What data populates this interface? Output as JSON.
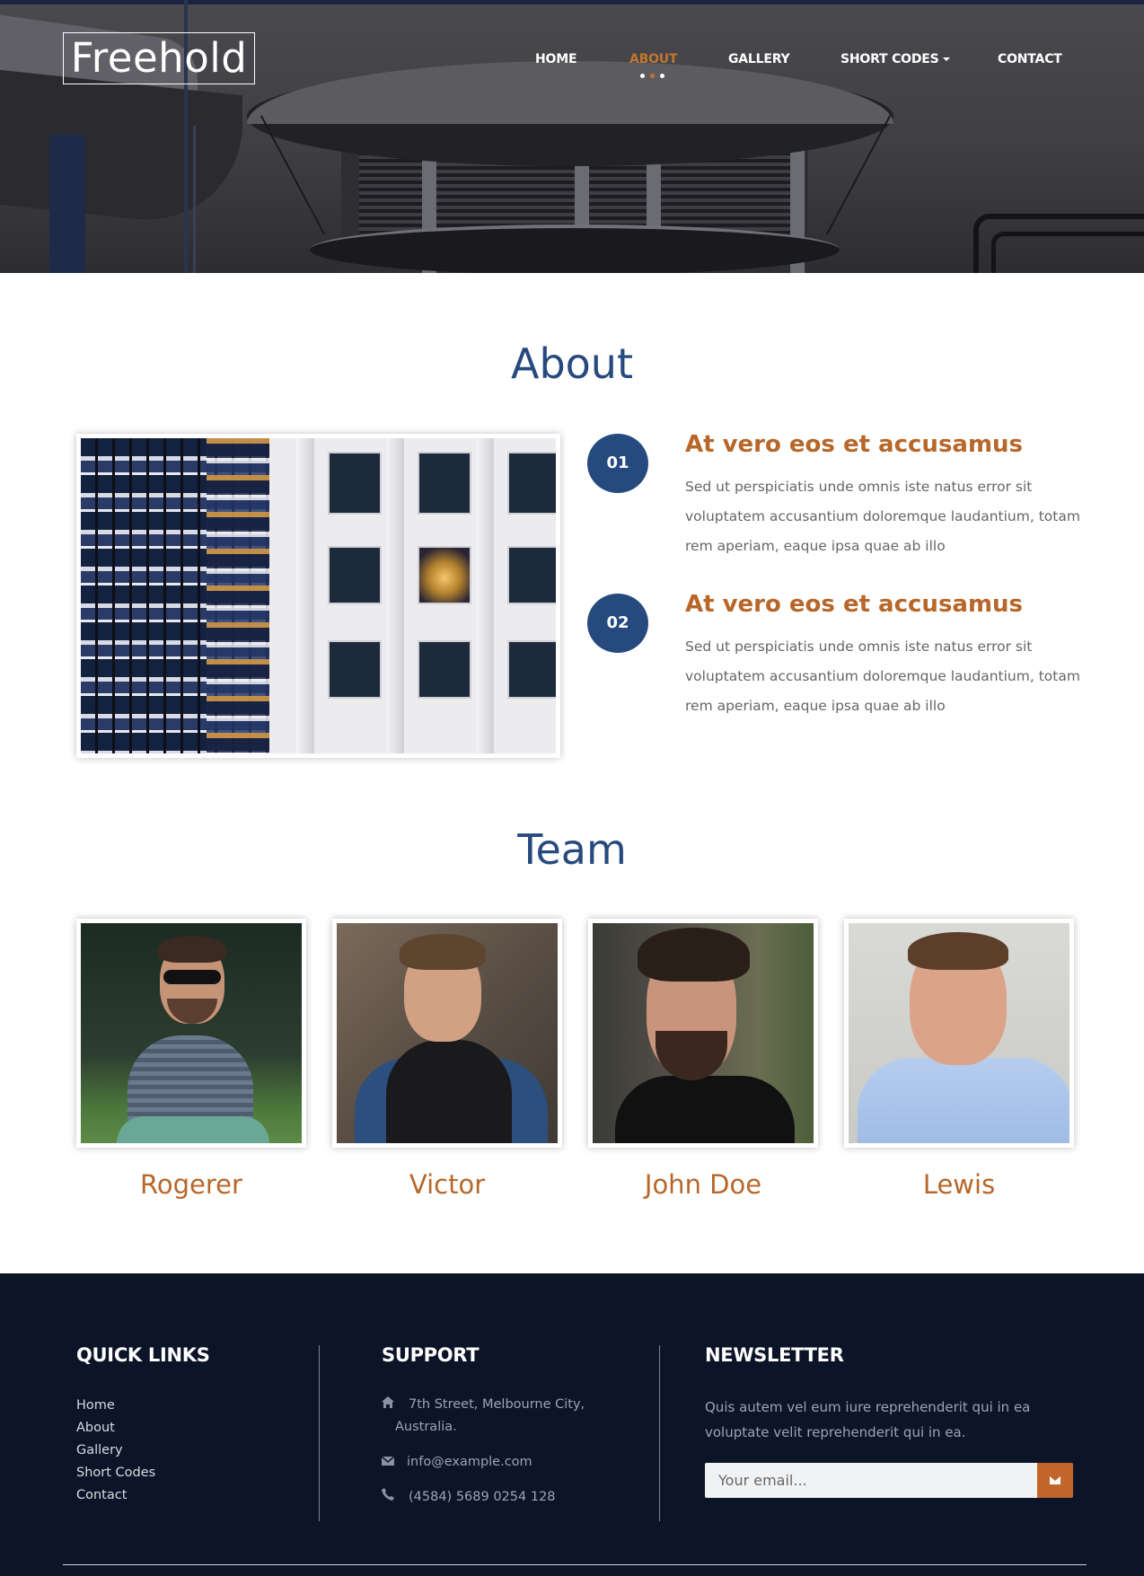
{
  "brand": {
    "logo": "Freehold"
  },
  "nav": {
    "items": [
      {
        "label": "HOME"
      },
      {
        "label": "ABOUT"
      },
      {
        "label": "GALLERY"
      },
      {
        "label": "SHORT CODES"
      },
      {
        "label": "CONTACT"
      }
    ],
    "active": "ABOUT"
  },
  "about": {
    "title": "About",
    "items": [
      {
        "num": "01",
        "title": "At vero eos et accusamus",
        "text": "Sed ut perspiciatis unde omnis iste natus error sit voluptatem accusantium doloremque laudantium, totam rem aperiam, eaque ipsa quae ab illo"
      },
      {
        "num": "02",
        "title": "At vero eos et accusamus",
        "text": "Sed ut perspiciatis unde omnis iste natus error sit voluptatem accusantium doloremque laudantium, totam rem aperiam, eaque ipsa quae ab illo"
      }
    ]
  },
  "team": {
    "title": "Team",
    "members": [
      {
        "name": "Rogerer"
      },
      {
        "name": "Victor"
      },
      {
        "name": "John Doe"
      },
      {
        "name": "Lewis"
      }
    ]
  },
  "footer": {
    "quick_links": {
      "title": "QUICK LINKS",
      "links": [
        "Home",
        "About",
        "Gallery",
        "Short Codes",
        "Contact"
      ]
    },
    "support": {
      "title": "SUPPORT",
      "address_line1": "7th Street, Melbourne City,",
      "address_line2": "Australia.",
      "email": "info@example.com",
      "phone": "(4584) 5689 0254 128"
    },
    "newsletter": {
      "title": "NEWSLETTER",
      "text": "Quis autem vel eum iure reprehenderit qui in ea voluptate velit reprehenderit qui in ea.",
      "placeholder": "Your email..."
    }
  },
  "colors": {
    "accent": "#b7672a",
    "primary": "#274a7e",
    "footer_bg": "#0c1427"
  },
  "icons": [
    "home-icon",
    "envelope-icon",
    "phone-icon",
    "send-envelope-icon",
    "caret-down-icon"
  ]
}
